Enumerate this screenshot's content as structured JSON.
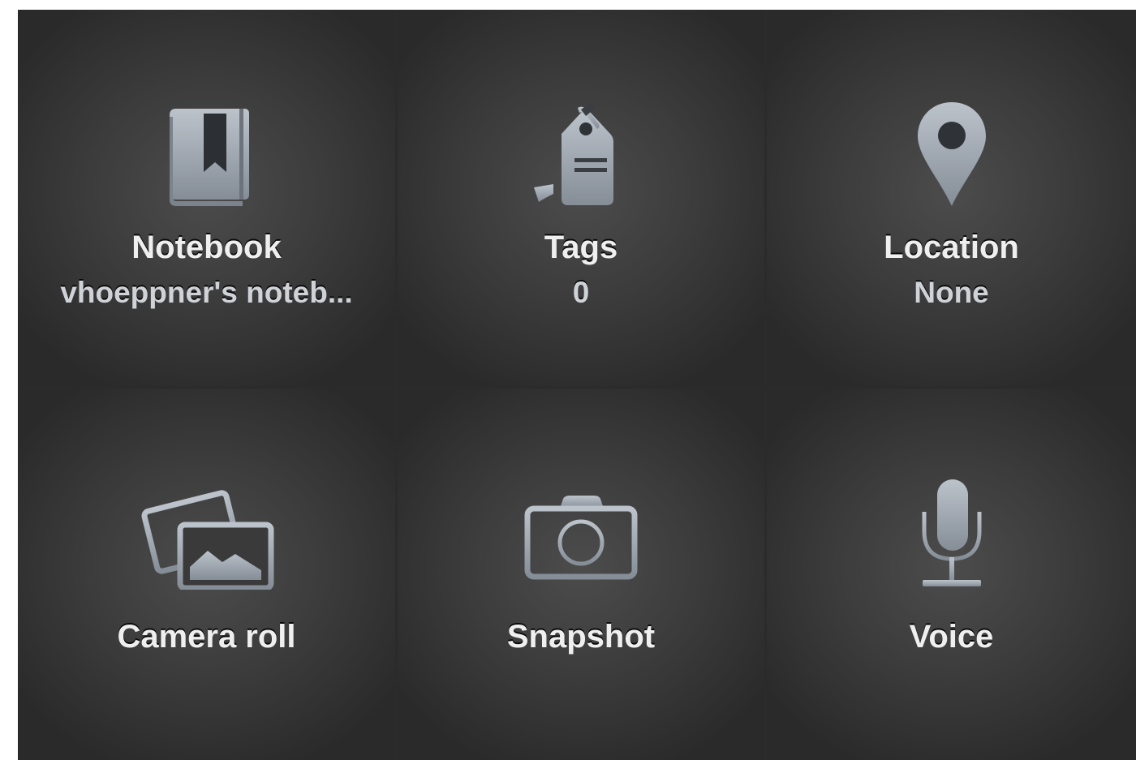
{
  "options": {
    "notebook": {
      "label": "Notebook",
      "value": "vhoeppner's noteb...",
      "icon": "notebook-icon"
    },
    "tags": {
      "label": "Tags",
      "value": "0",
      "icon": "tag-icon"
    },
    "location": {
      "label": "Location",
      "value": "None",
      "icon": "location-pin-icon"
    },
    "camera_roll": {
      "label": "Camera roll",
      "icon": "photos-icon"
    },
    "snapshot": {
      "label": "Snapshot",
      "icon": "camera-icon"
    },
    "voice": {
      "label": "Voice",
      "icon": "microphone-icon"
    }
  },
  "colors": {
    "background": "#2b2b2b",
    "tile_center": "#4c4c4c",
    "icon": "#9aa2ab",
    "text": "#efefef",
    "subtext": "#cfd3d8"
  }
}
